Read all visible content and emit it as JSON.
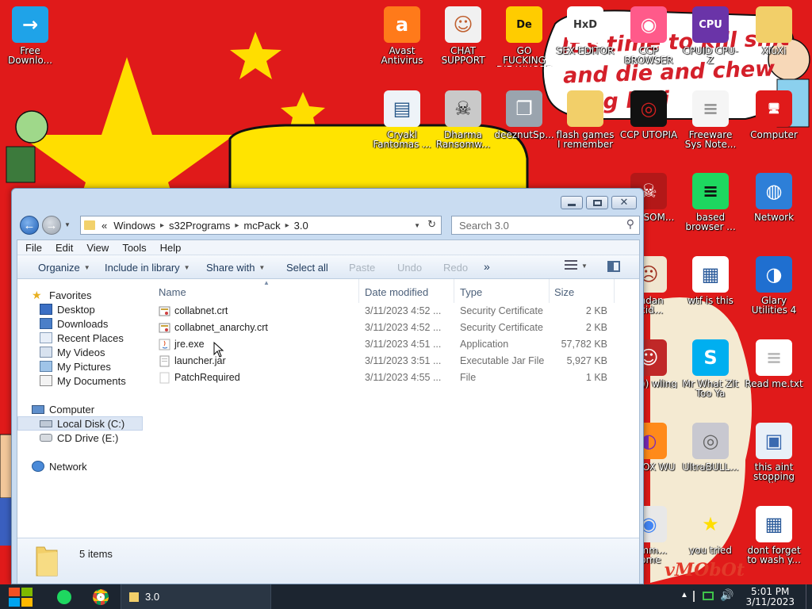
{
  "desktop": {
    "bubble_lines": [
      "It's time to kill shit",
      "and die and chew",
      "ing killi"
    ],
    "corner_text": "vMObOt",
    "icons": [
      {
        "id": "free-download",
        "label": "Free Downlo...",
        "icon": "arrow-right-icon"
      },
      {
        "id": "avast",
        "label": "Avast Antivirus",
        "icon": "avast-icon"
      },
      {
        "id": "chat-support",
        "label": "CHAT SUPPORT",
        "icon": "doctor-icon"
      },
      {
        "id": "go-fucking",
        "label": "GO FUCKING DIE WHORE",
        "icon": "de-icon"
      },
      {
        "id": "hex-editor",
        "label": "SEX EDITOR",
        "icon": "hxd-icon"
      },
      {
        "id": "ccp-browser",
        "label": "CCP BROWSER",
        "icon": "browser-icon"
      },
      {
        "id": "cpuz",
        "label": "CPUID CPU-Z",
        "icon": "cpuz-icon"
      },
      {
        "id": "xiuxiu",
        "label": "XiuXi",
        "icon": "folder-icon"
      },
      {
        "id": "cryakl",
        "label": "Cryakl Fantomas ...",
        "icon": "window-icon"
      },
      {
        "id": "dharma",
        "label": "Dharma Ransomw...",
        "icon": "skull-icon"
      },
      {
        "id": "deeznut",
        "label": "deeznutSp...",
        "icon": "stack-icon"
      },
      {
        "id": "flash-games",
        "label": "flash games I remember",
        "icon": "folder-icon"
      },
      {
        "id": "ccp-utopia",
        "label": "CCP UTOPIA",
        "icon": "utopia-icon"
      },
      {
        "id": "freeware",
        "label": "Freeware Sys Note...",
        "icon": "document-icon"
      },
      {
        "id": "computer",
        "label": "Computer",
        "icon": "computer-icon"
      },
      {
        "id": "tya",
        "label": "TYA SOM...",
        "icon": "skull-red-icon"
      },
      {
        "id": "based-browser",
        "label": "based browser ...",
        "icon": "chat-icon"
      },
      {
        "id": "network",
        "label": "Network",
        "icon": "globe-icon"
      },
      {
        "id": "andan",
        "label": "andan ocid...",
        "icon": "meme-icon"
      },
      {
        "id": "wtf",
        "label": "wtf is this",
        "icon": "calendar-icon"
      },
      {
        "id": "glary",
        "label": "Glary Utilities 4",
        "icon": "glary-icon"
      },
      {
        "id": "bowling",
        "label": "hey))) wling",
        "icon": "santa-icon"
      },
      {
        "id": "skype",
        "label": "Mr What Zit Too Ya",
        "icon": "skype-icon"
      },
      {
        "id": "readme",
        "label": "Read me.txt",
        "icon": "text-file-icon"
      },
      {
        "id": "firefox",
        "label": "KY FOX WU",
        "icon": "firefox-icon"
      },
      {
        "id": "ultrabull",
        "label": "UltraBULL...",
        "icon": "disc-icon"
      },
      {
        "id": "this-aint",
        "label": "this aint stopping di...",
        "icon": "installer-icon"
      },
      {
        "id": "chrome",
        "label": "mmm... rome",
        "icon": "chrome-icon"
      },
      {
        "id": "you-tried",
        "label": "you tried",
        "icon": "star-icon"
      },
      {
        "id": "dont-forget",
        "label": "dont forget to wash y...",
        "icon": "calendar-icon"
      }
    ]
  },
  "window": {
    "address": {
      "overflow": "«",
      "crumbs": [
        "Windows",
        "s32Programs",
        "mcPack",
        "3.0"
      ]
    },
    "search_placeholder": "Search 3.0",
    "menu": [
      "File",
      "Edit",
      "View",
      "Tools",
      "Help"
    ],
    "commands": {
      "organize": "Organize",
      "include": "Include in library",
      "share": "Share with",
      "select_all": "Select all",
      "paste": "Paste",
      "undo": "Undo",
      "redo": "Redo",
      "more": "»"
    },
    "nav": {
      "favorites": "Favorites",
      "desktop": "Desktop",
      "downloads": "Downloads",
      "recent": "Recent Places",
      "videos": "My Videos",
      "pictures": "My Pictures",
      "documents": "My Documents",
      "computer": "Computer",
      "local_disk": "Local Disk (C:)",
      "cd_drive": "CD Drive (E:)",
      "network": "Network"
    },
    "columns": {
      "name": "Name",
      "date": "Date modified",
      "type": "Type",
      "size": "Size"
    },
    "files": [
      {
        "name": "collabnet.crt",
        "date": "3/11/2023 4:52 ...",
        "type": "Security Certificate",
        "size": "2 KB",
        "icon": "certificate-icon"
      },
      {
        "name": "collabnet_anarchy.crt",
        "date": "3/11/2023 4:52 ...",
        "type": "Security Certificate",
        "size": "2 KB",
        "icon": "certificate-icon"
      },
      {
        "name": "jre.exe",
        "date": "3/11/2023 4:51 ...",
        "type": "Application",
        "size": "57,782 KB",
        "icon": "java-icon"
      },
      {
        "name": "launcher.jar",
        "date": "3/11/2023 3:51 ...",
        "type": "Executable Jar File",
        "size": "5,927 KB",
        "icon": "jar-icon"
      },
      {
        "name": "PatchRequired",
        "date": "3/11/2023 4:55 ...",
        "type": "File",
        "size": "1 KB",
        "icon": "blank-file-icon"
      }
    ],
    "status": "5 items"
  },
  "taskbar": {
    "open_window": "3.0",
    "time": "5:01 PM",
    "date": "3/11/2023"
  },
  "colors": {
    "wallpaper": "#e01a1a",
    "star": "#ffde00",
    "taskbar": "#1c2530"
  }
}
